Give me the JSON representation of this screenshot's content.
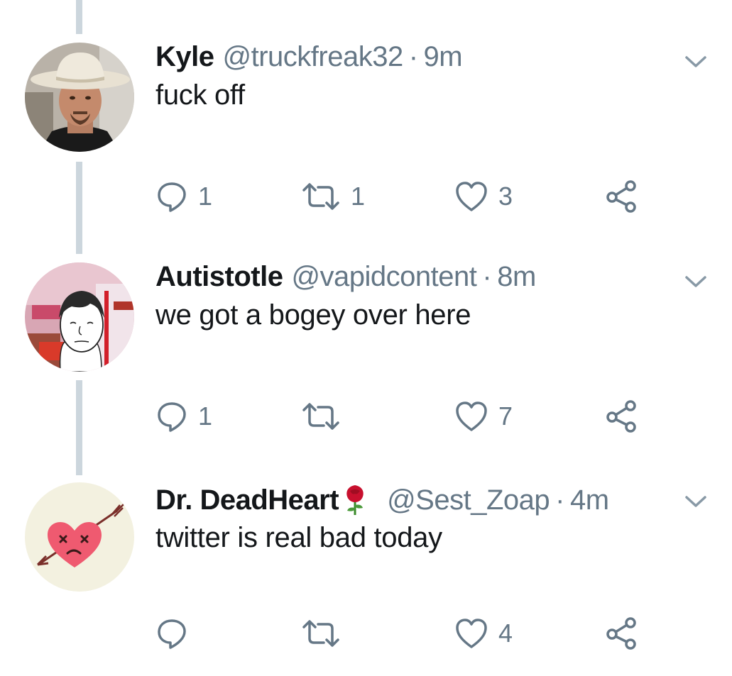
{
  "tweets": [
    {
      "name": "Kyle",
      "handle": "@truckfreak32",
      "separator": "·",
      "time": "9m",
      "text": "fuck off",
      "reply_count": "1",
      "retweet_count": "1",
      "like_count": "3",
      "avatar": "cowboy-hat-man-avatar"
    },
    {
      "name": "Autistotle",
      "handle": "@vapidcontent",
      "separator": "·",
      "time": "8m",
      "text": "we got a bogey over here",
      "reply_count": "1",
      "retweet_count": "",
      "like_count": "7",
      "avatar": "wojak-avatar"
    },
    {
      "name": "Dr. DeadHeart",
      "handle": "@Sest_Zoap",
      "separator": "·",
      "time": "4m",
      "text": "twitter is real bad today",
      "reply_count": "",
      "retweet_count": "",
      "like_count": "4",
      "avatar": "dead-heart-arrow-avatar",
      "name_emoji": "rose-icon"
    }
  ],
  "colors": {
    "text": "#14171a",
    "secondary": "#657786",
    "thread_line": "#ccd6dd"
  },
  "icons": [
    "reply-icon",
    "retweet-icon",
    "like-icon",
    "share-icon",
    "chevron-down-icon"
  ]
}
